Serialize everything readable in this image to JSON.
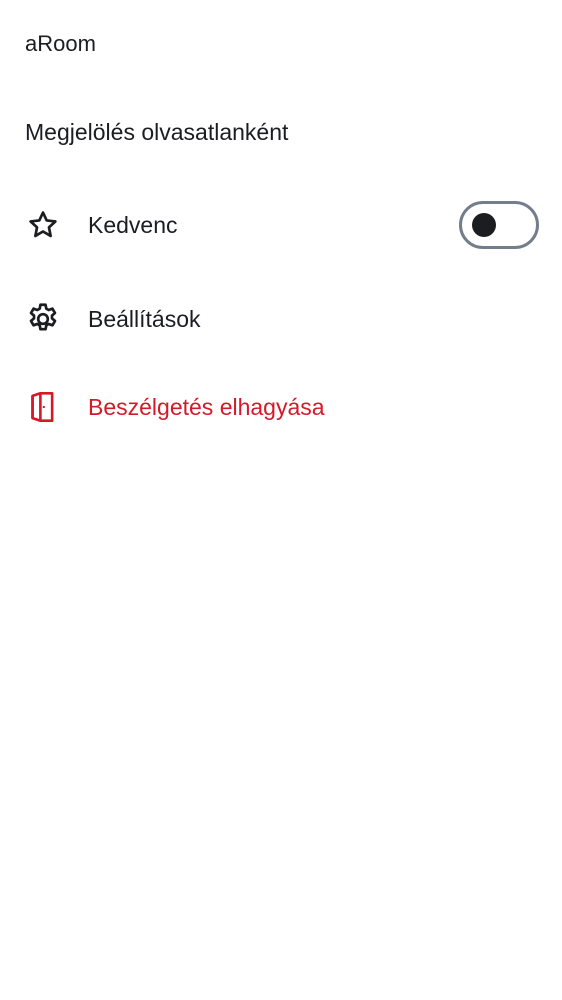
{
  "room": {
    "name": "aRoom"
  },
  "menu": {
    "mark_unread_label": "Megjelölés olvasatlanként",
    "favourite_label": "Kedvenc",
    "favourite_enabled": false,
    "settings_label": "Beállítások",
    "leave_label": "Beszélgetés elhagyása"
  },
  "icons": {
    "favourite": "star-icon",
    "settings": "gear-icon",
    "leave": "door-exit-icon"
  },
  "colors": {
    "text": "#1b1d21",
    "danger": "#d51928",
    "toggle_border": "#737d8c"
  }
}
